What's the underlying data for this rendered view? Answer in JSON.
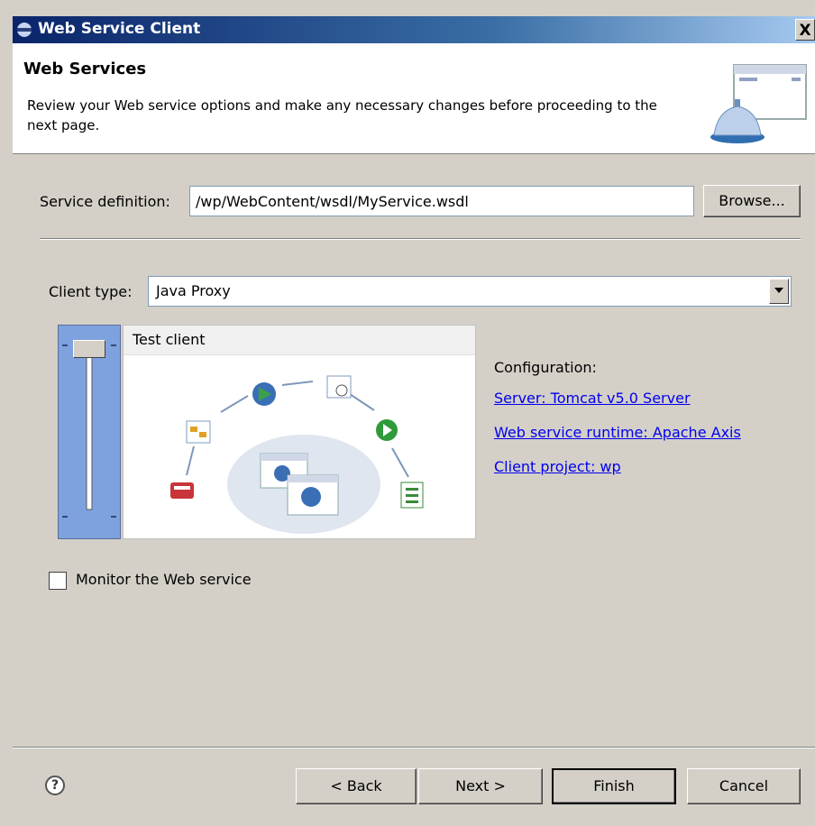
{
  "window": {
    "title": "Web Service Client",
    "close_label": "X"
  },
  "banner": {
    "title": "Web Services",
    "description": "Review your Web service options and make any necessary changes before proceeding to the next page."
  },
  "service_definition": {
    "label": "Service definition:",
    "value": "/wp/WebContent/wsdl/MyService.wsdl",
    "browse_label": "Browse..."
  },
  "client_type": {
    "label": "Client type:",
    "value": "Java Proxy"
  },
  "slider": {
    "panel_title": "Test client"
  },
  "configuration": {
    "label": "Configuration:",
    "links": [
      "Server: Tomcat v5.0 Server",
      "Web service runtime: Apache Axis",
      "Client project: wp"
    ]
  },
  "monitor": {
    "label": "Monitor the Web service",
    "checked": false
  },
  "footer": {
    "help_label": "?",
    "back_label": "< Back",
    "next_label": "Next >",
    "finish_label": "Finish",
    "cancel_label": "Cancel"
  }
}
